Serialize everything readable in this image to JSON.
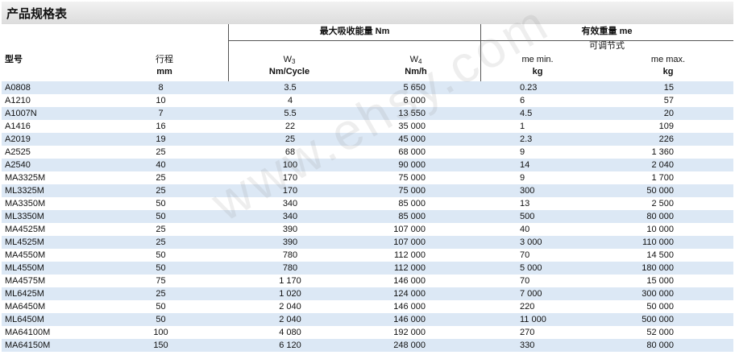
{
  "title": "产品规格表",
  "header": {
    "model": "型号",
    "stroke": "行程",
    "stroke_unit": "mm",
    "energy_group": "最大吸收能量 Nm",
    "w3": "W",
    "w3_sub": "3",
    "w3_unit": "Nm/Cycle",
    "w4": "W",
    "w4_sub": "4",
    "w4_unit": "Nm/h",
    "mass_group": "有效重量 me",
    "adjustable": "可调节式",
    "me_min": "me min.",
    "me_min_unit": "kg",
    "me_max": "me max.",
    "me_max_unit": "kg"
  },
  "rows": [
    [
      "A0808",
      "8",
      "3.5",
      "5 650",
      "0.23",
      "15"
    ],
    [
      "A1210",
      "10",
      "4",
      "6 000",
      "6",
      "57"
    ],
    [
      "A1007N",
      "7",
      "5.5",
      "13 550",
      "4.5",
      "20"
    ],
    [
      "A1416",
      "16",
      "22",
      "35 000",
      "1",
      "109"
    ],
    [
      "A2019",
      "19",
      "25",
      "45 000",
      "2.3",
      "226"
    ],
    [
      "A2525",
      "25",
      "68",
      "68 000",
      "9",
      "1 360"
    ],
    [
      "A2540",
      "40",
      "100",
      "90 000",
      "14",
      "2 040"
    ],
    [
      "MA3325M",
      "25",
      "170",
      "75 000",
      "9",
      "1 700"
    ],
    [
      "ML3325M",
      "25",
      "170",
      "75 000",
      "300",
      "50 000"
    ],
    [
      "MA3350M",
      "50",
      "340",
      "85 000",
      "13",
      "2 500"
    ],
    [
      "ML3350M",
      "50",
      "340",
      "85 000",
      "500",
      "80 000"
    ],
    [
      "MA4525M",
      "25",
      "390",
      "107 000",
      "40",
      "10 000"
    ],
    [
      "ML4525M",
      "25",
      "390",
      "107 000",
      "3 000",
      "110 000"
    ],
    [
      "MA4550M",
      "50",
      "780",
      "112 000",
      "70",
      "14 500"
    ],
    [
      "ML4550M",
      "50",
      "780",
      "112 000",
      "5 000",
      "180 000"
    ],
    [
      "MA4575M",
      "75",
      "1 170",
      "146 000",
      "70",
      "15 000"
    ],
    [
      "ML6425M",
      "25",
      "1 020",
      "124 000",
      "7 000",
      "300 000"
    ],
    [
      "MA6450M",
      "50",
      "2 040",
      "146 000",
      "220",
      "50 000"
    ],
    [
      "ML6450M",
      "50",
      "2 040",
      "146 000",
      "11 000",
      "500 000"
    ],
    [
      "MA64100M",
      "100",
      "4 080",
      "192 000",
      "270",
      "52 000"
    ],
    [
      "MA64150M",
      "150",
      "6 120",
      "248 000",
      "330",
      "80 000"
    ]
  ],
  "watermark": "www.ehsy.com"
}
